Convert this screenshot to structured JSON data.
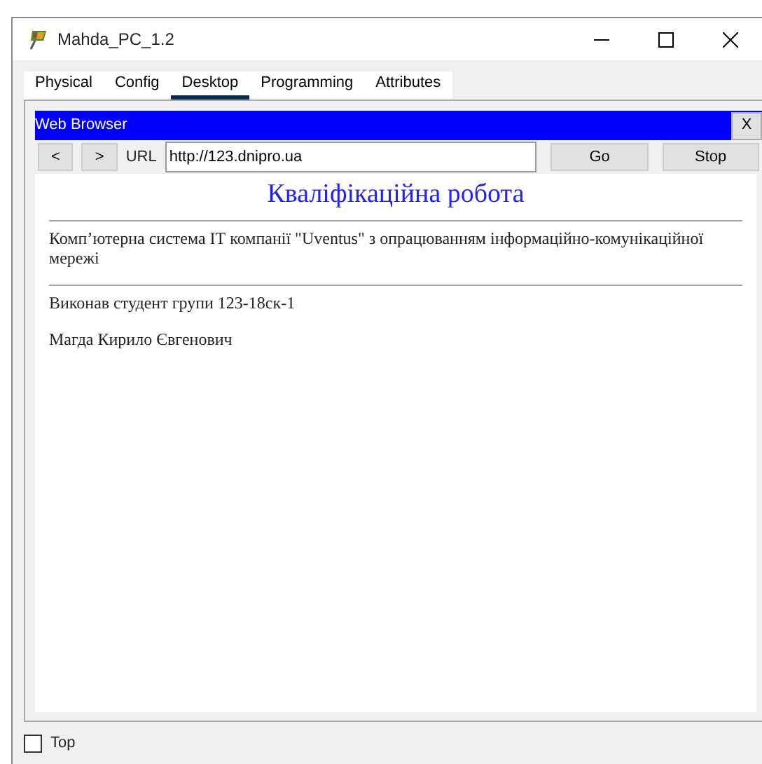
{
  "window": {
    "title": "Mahda_PC_1.2"
  },
  "tabs": [
    {
      "label": "Physical",
      "selected": false
    },
    {
      "label": "Config",
      "selected": false
    },
    {
      "label": "Desktop",
      "selected": true
    },
    {
      "label": "Programming",
      "selected": false
    },
    {
      "label": "Attributes",
      "selected": false
    }
  ],
  "browser": {
    "title": "Web Browser",
    "close": "X",
    "back": "<",
    "forward": ">",
    "url_label": "URL",
    "url": "http://123.dnipro.ua",
    "go": "Go",
    "stop": "Stop",
    "page": {
      "heading": "Кваліфікаційна робота",
      "paragraphs": [
        "Комп’ютерна система ІТ компанії \"Uventus\" з опрацюванням інформаційно-комунікаційної мережі"
      ],
      "lines": [
        "Виконав студент групи 123-18ск-1",
        "Магда Кирило Євгенович"
      ]
    }
  },
  "top_checkbox": {
    "label": "Top",
    "checked": false
  }
}
